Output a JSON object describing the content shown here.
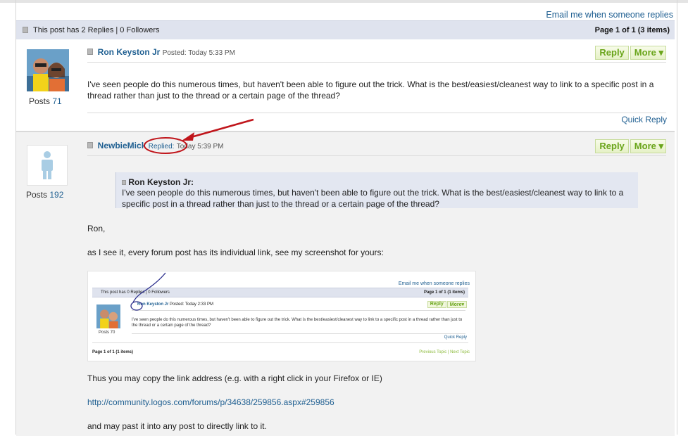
{
  "header": {
    "email_link": "Email me when someone replies",
    "reply_count": "This post has 2 Replies | 0 Followers",
    "pager": "Page 1 of 1 (3 items)"
  },
  "posts": [
    {
      "author": "Ron Keyston Jr",
      "posted": "Posted: Today 5:33 PM",
      "posts_label": "Posts",
      "posts_count": "71",
      "body": "I've seen people do this numerous times, but haven't been able to figure out the trick.  What is the best/easiest/cleanest way to link to a specific post in a thread rather than just to the thread or a certain page of the thread?",
      "reply_label": "Reply",
      "more_label": "More ▾",
      "quick_reply": "Quick Reply"
    },
    {
      "author": "NewbieMick",
      "replied": "Replied:",
      "posted": "Today 5:39 PM",
      "posts_label": "Posts",
      "posts_count": "192",
      "reply_label": "Reply",
      "more_label": "More ▾",
      "quote_author": "Ron Keyston Jr:",
      "quote_text": "I've seen people do this numerous times, but haven't been able to figure out the trick.  What is the best/easiest/cleanest way to link to a specific post in a thread rather than just to the thread or a certain page of the thread?",
      "p1": "Ron,",
      "p2": "as I see it, every forum post has its individual link, see my screenshot for yours:",
      "p3": "Thus you may copy the link address (e.g. with a right click in your Firefox or IE)",
      "link": "http://community.logos.com/forums/p/34638/259856.aspx#259856",
      "p4": "and may past it into any post to directly link to it."
    }
  ],
  "embedded_screenshot": {
    "email_link": "Email me when someone replies",
    "reply_count": "This post has 0 Replies | 0 Followers",
    "pager": "Page 1 of 1 (1 items)",
    "author": "Ron Keyston Jr",
    "posted": "Posted: Today 2:33 PM",
    "reply_label": "Reply",
    "more_label": "More▾",
    "body": "I've seen people do this numerous times, but haven't been able to figure out the trick.  What is the best/easiest/cleanest way to link to a specific post in a thread rather than just to the thread or a certain page of the thread?",
    "posts": "Posts 70",
    "quick_reply": "Quick Reply",
    "pager_bottom": "Page 1 of 1 (1 items)",
    "nav": "Previous Topic | Next Topic"
  },
  "colors": {
    "link": "#1f5f91",
    "button_text": "#6aa51b",
    "header_bar": "#dfe3ee",
    "annotation": "#c0151b"
  }
}
